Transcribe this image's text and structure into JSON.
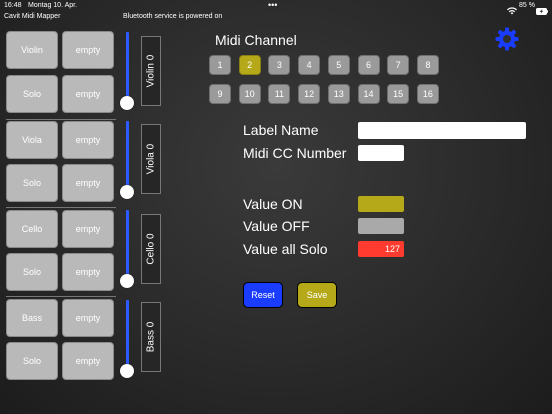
{
  "status_bar": {
    "time": "16:48",
    "date": "Montag 10. Apr.",
    "dots": "•••",
    "battery_percent": "85 %"
  },
  "header": {
    "app_name": "Cavit Midi Mapper",
    "bluetooth_status": "Bluetooth service is powered on"
  },
  "groups": [
    {
      "top_label": "Violin",
      "top_right": "empty",
      "solo_label": "Solo",
      "solo_right": "empty",
      "slider_label": "Violin 0"
    },
    {
      "top_label": "Viola",
      "top_right": "empty",
      "solo_label": "Solo",
      "solo_right": "empty",
      "slider_label": "Viola 0"
    },
    {
      "top_label": "Cello",
      "top_right": "empty",
      "solo_label": "Solo",
      "solo_right": "empty",
      "slider_label": "Cello 0"
    },
    {
      "top_label": "Bass",
      "top_right": "empty",
      "solo_label": "Solo",
      "solo_right": "empty",
      "slider_label": "Bass 0"
    }
  ],
  "midi": {
    "title": "Midi Channel",
    "channels": [
      "1",
      "2",
      "3",
      "4",
      "5",
      "6",
      "7",
      "8",
      "9",
      "10",
      "11",
      "12",
      "13",
      "14",
      "15",
      "16"
    ],
    "selected": "2"
  },
  "form": {
    "label_name": "Label Name",
    "label_name_value": "",
    "midi_cc": "Midi CC Number",
    "midi_cc_value": "",
    "value_on": "Value ON",
    "value_off": "Value OFF",
    "value_all_solo": "Value all Solo",
    "value_all_solo_value": "127"
  },
  "colors": {
    "value_on": "#b5a91a",
    "value_off": "#a9a9a9",
    "value_all_solo": "#ff3b30",
    "accent_blue": "#1a3cff",
    "save_olive": "#b5a91a"
  },
  "buttons": {
    "reset": "Reset",
    "save": "Save"
  },
  "icons": {
    "settings": "gear-icon",
    "wifi": "wifi-icon",
    "battery": "battery-icon"
  }
}
